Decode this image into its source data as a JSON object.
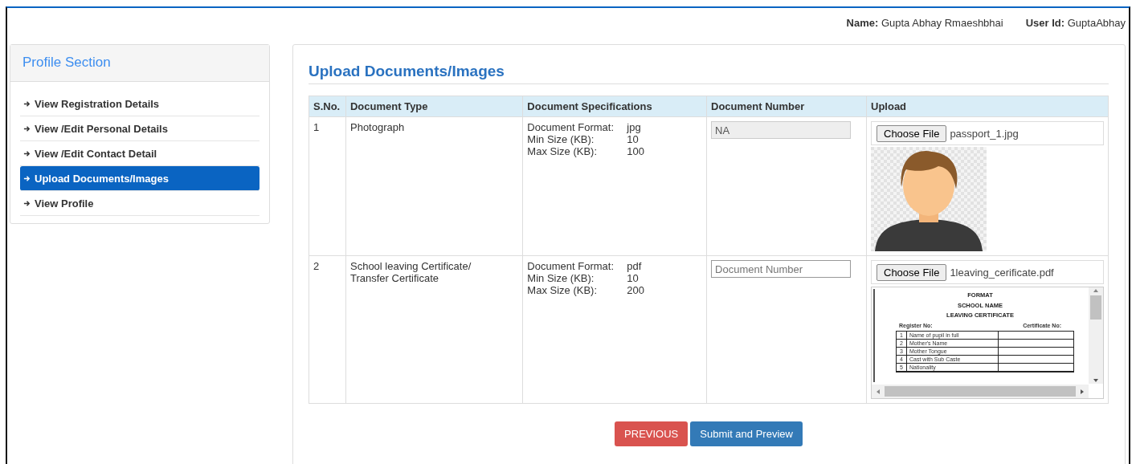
{
  "user_bar": {
    "name_label": "Name:",
    "name_value": "Gupta Abhay Rmaeshbhai",
    "id_label": "User Id:",
    "id_value": "GuptaAbhay"
  },
  "sidebar": {
    "title": "Profile Section",
    "items": [
      {
        "label": "View Registration Details",
        "selected": false
      },
      {
        "label": "View /Edit Personal Details",
        "selected": false
      },
      {
        "label": "View /Edit Contact Detail",
        "selected": false
      },
      {
        "label": "Upload Documents/Images",
        "selected": true
      },
      {
        "label": "View Profile",
        "selected": false
      }
    ]
  },
  "main": {
    "title": "Upload Documents/Images",
    "table": {
      "columns": [
        "S.No.",
        "Document Type",
        "Document Specifications",
        "Document Number",
        "Upload"
      ],
      "rows": [
        {
          "sno": "1",
          "type": [
            "Photograph"
          ],
          "specs": [
            {
              "label": "Document Format:",
              "value": "jpg"
            },
            {
              "label": "Min Size (KB):",
              "value": "10"
            },
            {
              "label": "Max Size (KB):",
              "value": "100"
            }
          ],
          "number": {
            "value": "NA",
            "disabled": true
          },
          "upload": {
            "button": "Choose File",
            "file": "passport_1.jpg",
            "kind": "photo"
          }
        },
        {
          "sno": "2",
          "type": [
            "School leaving Certificate/",
            "Transfer Certificate"
          ],
          "specs": [
            {
              "label": "Document Format:",
              "value": "pdf"
            },
            {
              "label": "Min Size (KB):",
              "value": "10"
            },
            {
              "label": "Max Size (KB):",
              "value": "200"
            }
          ],
          "number": {
            "placeholder": "Document Number",
            "disabled": false
          },
          "upload": {
            "button": "Choose File",
            "file": "1leaving_cerificate.pdf",
            "kind": "document",
            "preview": {
              "headings": [
                "FORMAT",
                "SCHOOL NAME",
                "LEAVING CERTIFICATE"
              ],
              "register_label": "Register No:",
              "certificate_label": "Certificate No:",
              "rows": [
                {
                  "no": "1",
                  "label": "Name of pupil in full"
                },
                {
                  "no": "2",
                  "label": "Mother's Name"
                },
                {
                  "no": "3",
                  "label": "Mother Tongue"
                },
                {
                  "no": "4",
                  "label": "Cast with Sub Caste"
                },
                {
                  "no": "5",
                  "label": "Nationality"
                }
              ]
            }
          }
        }
      ]
    },
    "buttons": [
      {
        "label": "PREVIOUS",
        "kind": "danger"
      },
      {
        "label": "Submit and Preview",
        "kind": "primary"
      }
    ]
  }
}
